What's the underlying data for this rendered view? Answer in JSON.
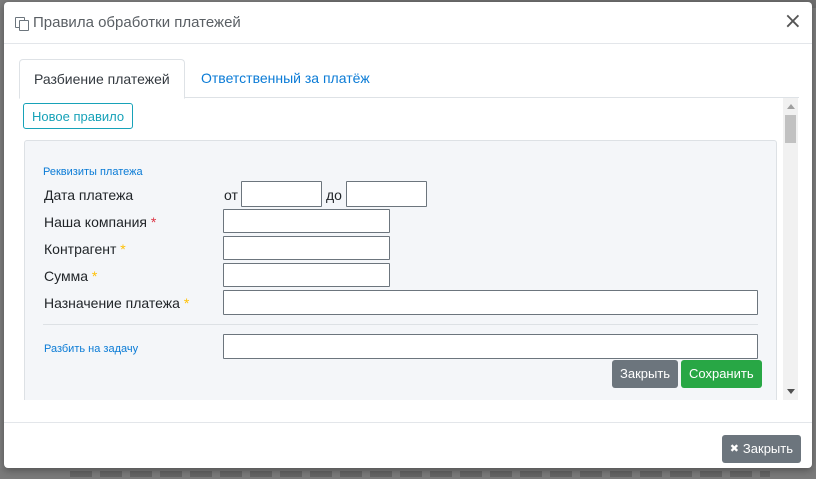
{
  "modal": {
    "title": "Правила обработки платежей",
    "title_icon": "copy-icon",
    "close_symbol": "×"
  },
  "tabs": [
    {
      "label": "Разбиение платежей",
      "active": true
    },
    {
      "label": "Ответственный за платёж",
      "active": false
    }
  ],
  "new_rule_label": "Новое правило",
  "form": {
    "section_label": "Реквизиты платежа",
    "payment_date_label": "Дата платежа",
    "from_label": "от",
    "to_label": "до",
    "date_from_value": "",
    "date_to_value": "",
    "our_company_label": "Наша компания",
    "our_company_value": "",
    "counterparty_label": "Контрагент",
    "counterparty_value": "",
    "amount_label": "Сумма",
    "amount_value": "",
    "purpose_label": "Назначение платежа",
    "purpose_value": "",
    "required_marker": "*",
    "split_label": "Разбить на задачу",
    "split_value": "",
    "close_label": "Закрыть",
    "save_label": "Сохранить"
  },
  "footer": {
    "close_label": "Закрыть",
    "close_icon_symbol": "✖"
  },
  "colors": {
    "primary_link": "#0a7bd6",
    "info": "#17a2b8",
    "success": "#28a745",
    "secondary": "#6c757d",
    "required_red": "#dc3545",
    "required_yellow": "#ffc107"
  }
}
